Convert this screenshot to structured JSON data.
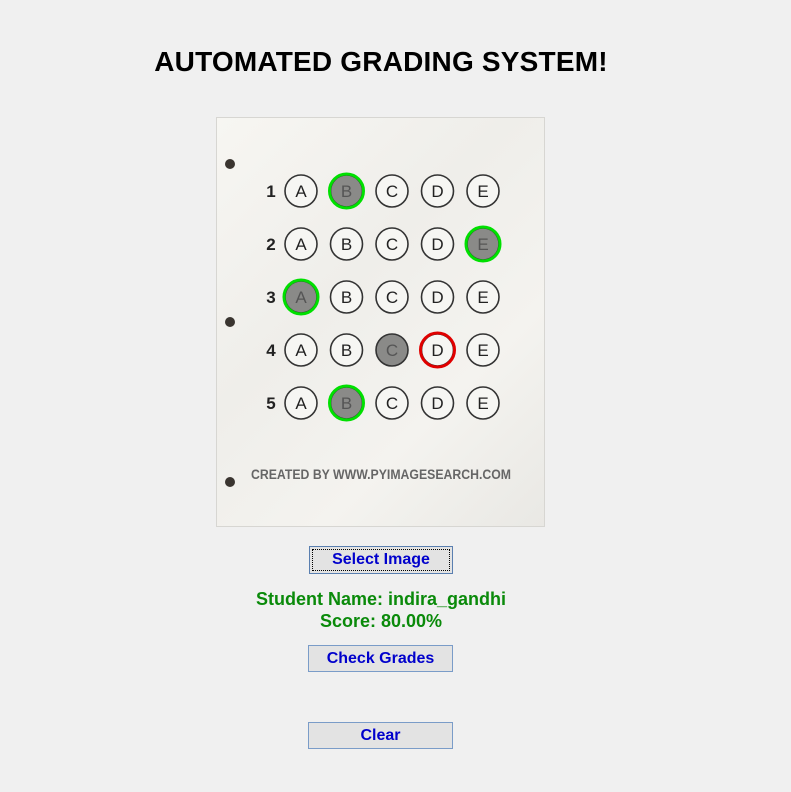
{
  "window": {
    "title": "AUTOMATED GRADING SYSTEM!"
  },
  "sheet": {
    "footer_text": "CREATED BY WWW.PYIMAGESEARCH.COM",
    "options": [
      "A",
      "B",
      "C",
      "D",
      "E"
    ],
    "questions": [
      {
        "number": "1",
        "marked": "B",
        "correct": "B"
      },
      {
        "number": "2",
        "marked": "E",
        "correct": "E"
      },
      {
        "number": "3",
        "marked": "A",
        "correct": "A"
      },
      {
        "number": "4",
        "marked": "C",
        "correct": "D"
      },
      {
        "number": "5",
        "marked": "B",
        "correct": "B"
      }
    ],
    "colors": {
      "correct_ring": "#00e000",
      "wrong_ring": "#e00000",
      "bubble_fill": "#8a8a88"
    }
  },
  "buttons": {
    "select_image": "Select Image",
    "check_grades": "Check Grades",
    "clear": "Clear"
  },
  "result": {
    "student_name": "Student Name: indira_gandhi",
    "score": "Score: 80.00%",
    "color": "#0a8a0a"
  }
}
